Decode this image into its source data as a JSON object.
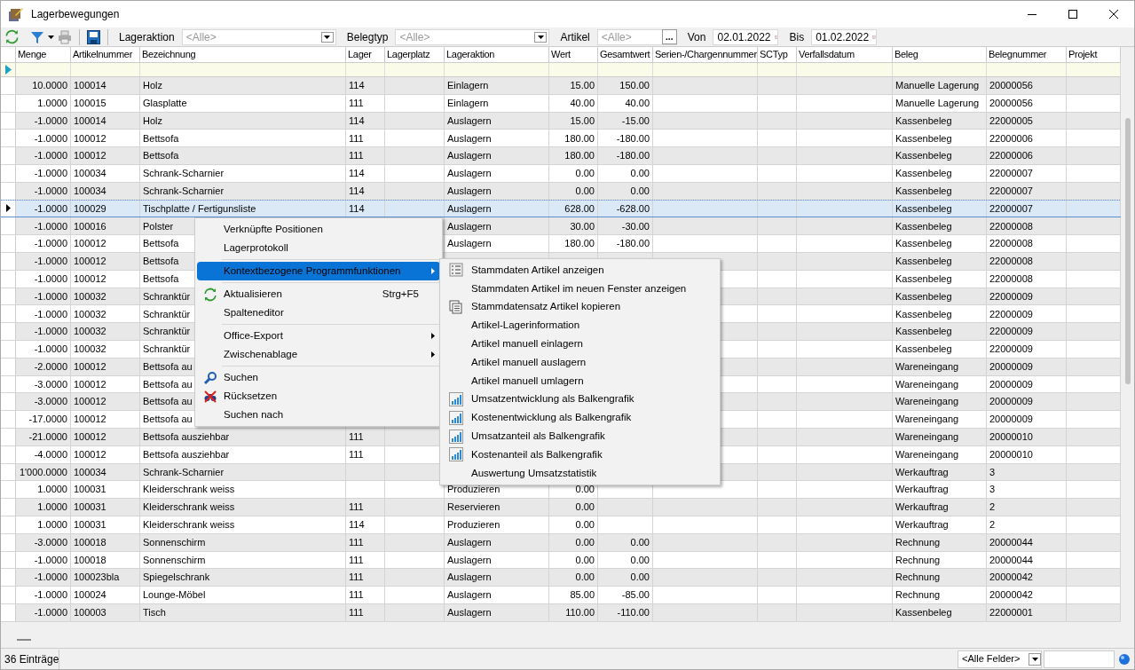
{
  "window": {
    "title": "Lagerbewegungen"
  },
  "toolbar": {
    "filters": [
      {
        "kind": "select",
        "label": "Lageraktion",
        "placeholder": "<Alle>"
      },
      {
        "kind": "select",
        "label": "Belegtyp",
        "placeholder": "<Alle>"
      },
      {
        "kind": "lookup",
        "label": "Artikel",
        "placeholder": "<Alle>",
        "button": "..."
      },
      {
        "kind": "date",
        "label": "Von",
        "value": "02.01.2022"
      },
      {
        "kind": "date",
        "label": "Bis",
        "value": "01.02.2022"
      }
    ]
  },
  "table": {
    "columns": [
      "Menge",
      "Artikelnummer",
      "Bezeichnung",
      "Lager",
      "Lagerplatz",
      "Lageraktion",
      "Wert",
      "Gesamtwert",
      "Serien-/Chargennummer",
      "SCTyp",
      "Verfallsdatum",
      "Beleg",
      "Belegnummer",
      "Projekt"
    ],
    "rows": [
      {
        "selected": false,
        "cells": [
          "10.0000",
          "100014",
          "Holz",
          "114",
          null,
          "Einlagern",
          "15.00",
          "150.00",
          null,
          null,
          null,
          "Manuelle Lagerung",
          "20000056",
          null
        ]
      },
      {
        "selected": false,
        "cells": [
          "1.0000",
          "100015",
          "Glasplatte",
          "111",
          null,
          "Einlagern",
          "40.00",
          "40.00",
          null,
          null,
          null,
          "Manuelle Lagerung",
          "20000056",
          null
        ]
      },
      {
        "selected": false,
        "cells": [
          "-1.0000",
          "100014",
          "Holz",
          "114",
          null,
          "Auslagern",
          "15.00",
          "-15.00",
          null,
          null,
          null,
          "Kassenbeleg",
          "22000005",
          null
        ]
      },
      {
        "selected": false,
        "cells": [
          "-1.0000",
          "100012",
          "Bettsofa",
          "111",
          null,
          "Auslagern",
          "180.00",
          "-180.00",
          null,
          null,
          null,
          "Kassenbeleg",
          "22000006",
          null
        ]
      },
      {
        "selected": false,
        "cells": [
          "-1.0000",
          "100012",
          "Bettsofa",
          "111",
          null,
          "Auslagern",
          "180.00",
          "-180.00",
          null,
          null,
          null,
          "Kassenbeleg",
          "22000006",
          null
        ]
      },
      {
        "selected": false,
        "cells": [
          "-1.0000",
          "100034",
          "Schrank-Scharnier",
          "114",
          null,
          "Auslagern",
          "0.00",
          "0.00",
          null,
          null,
          null,
          "Kassenbeleg",
          "22000007",
          null
        ]
      },
      {
        "selected": false,
        "cells": [
          "-1.0000",
          "100034",
          "Schrank-Scharnier",
          "114",
          null,
          "Auslagern",
          "0.00",
          "0.00",
          null,
          null,
          null,
          "Kassenbeleg",
          "22000007",
          null
        ]
      },
      {
        "selected": true,
        "cells": [
          "-1.0000",
          "100029",
          "Tischplatte / Fertigunsliste",
          "114",
          null,
          "Auslagern",
          "628.00",
          "-628.00",
          null,
          null,
          null,
          "Kassenbeleg",
          "22000007",
          null
        ]
      },
      {
        "selected": false,
        "cells": [
          "-1.0000",
          "100016",
          "Polster",
          null,
          null,
          "Auslagern",
          "30.00",
          "-30.00",
          null,
          null,
          null,
          "Kassenbeleg",
          "22000008",
          null
        ]
      },
      {
        "selected": false,
        "cells": [
          "-1.0000",
          "100012",
          "Bettsofa",
          null,
          null,
          "Auslagern",
          "180.00",
          "-180.00",
          null,
          null,
          null,
          "Kassenbeleg",
          "22000008",
          null
        ]
      },
      {
        "selected": false,
        "cells": [
          "-1.0000",
          "100012",
          "Bettsofa",
          null,
          null,
          null,
          null,
          null,
          null,
          null,
          null,
          "Kassenbeleg",
          "22000008",
          null
        ]
      },
      {
        "selected": false,
        "cells": [
          "-1.0000",
          "100012",
          "Bettsofa",
          null,
          null,
          null,
          null,
          null,
          null,
          null,
          null,
          "Kassenbeleg",
          "22000008",
          null
        ]
      },
      {
        "selected": false,
        "cells": [
          "-1.0000",
          "100032",
          "Schranktür",
          null,
          null,
          null,
          null,
          null,
          null,
          null,
          null,
          "Kassenbeleg",
          "22000009",
          null
        ]
      },
      {
        "selected": false,
        "cells": [
          "-1.0000",
          "100032",
          "Schranktür",
          null,
          null,
          null,
          null,
          null,
          null,
          null,
          null,
          "Kassenbeleg",
          "22000009",
          null
        ]
      },
      {
        "selected": false,
        "cells": [
          "-1.0000",
          "100032",
          "Schranktür",
          null,
          null,
          null,
          null,
          null,
          null,
          null,
          null,
          "Kassenbeleg",
          "22000009",
          null
        ]
      },
      {
        "selected": false,
        "cells": [
          "-1.0000",
          "100032",
          "Schranktür",
          null,
          null,
          null,
          null,
          null,
          null,
          null,
          null,
          "Kassenbeleg",
          "22000009",
          null
        ]
      },
      {
        "selected": false,
        "cells": [
          "-2.0000",
          "100012",
          "Bettsofa au",
          null,
          null,
          null,
          null,
          null,
          null,
          null,
          null,
          "Wareneingang",
          "20000009",
          null
        ]
      },
      {
        "selected": false,
        "cells": [
          "-3.0000",
          "100012",
          "Bettsofa au",
          null,
          null,
          null,
          null,
          null,
          null,
          null,
          null,
          "Wareneingang",
          "20000009",
          null
        ]
      },
      {
        "selected": false,
        "cells": [
          "-3.0000",
          "100012",
          "Bettsofa au",
          null,
          null,
          null,
          null,
          null,
          null,
          null,
          null,
          "Wareneingang",
          "20000009",
          null
        ]
      },
      {
        "selected": false,
        "cells": [
          "-17.0000",
          "100012",
          "Bettsofa au",
          null,
          null,
          null,
          null,
          null,
          null,
          null,
          null,
          "Wareneingang",
          "20000009",
          null
        ]
      },
      {
        "selected": false,
        "cells": [
          "-21.0000",
          "100012",
          "Bettsofa ausziehbar",
          "111",
          null,
          null,
          null,
          null,
          null,
          null,
          null,
          "Wareneingang",
          "20000010",
          null
        ]
      },
      {
        "selected": false,
        "cells": [
          "-4.0000",
          "100012",
          "Bettsofa ausziehbar",
          "111",
          null,
          null,
          null,
          null,
          null,
          null,
          null,
          "Wareneingang",
          "20000010",
          null
        ]
      },
      {
        "selected": false,
        "cells": [
          "1'000.0000",
          "100034",
          "Schrank-Scharnier",
          null,
          null,
          null,
          null,
          null,
          null,
          null,
          null,
          "Werkauftrag",
          "3",
          null
        ]
      },
      {
        "selected": false,
        "cells": [
          "1.0000",
          "100031",
          "Kleiderschrank weiss",
          null,
          null,
          "Produzieren",
          "0.00",
          null,
          null,
          null,
          null,
          "Werkauftrag",
          "3",
          null
        ]
      },
      {
        "selected": false,
        "cells": [
          "1.0000",
          "100031",
          "Kleiderschrank weiss",
          "111",
          null,
          "Reservieren",
          "0.00",
          null,
          null,
          null,
          null,
          "Werkauftrag",
          "2",
          null
        ]
      },
      {
        "selected": false,
        "cells": [
          "1.0000",
          "100031",
          "Kleiderschrank weiss",
          "114",
          null,
          "Produzieren",
          "0.00",
          null,
          null,
          null,
          null,
          "Werkauftrag",
          "2",
          null
        ]
      },
      {
        "selected": false,
        "cells": [
          "-3.0000",
          "100018",
          "Sonnenschirm",
          "111",
          null,
          "Auslagern",
          "0.00",
          "0.00",
          null,
          null,
          null,
          "Rechnung",
          "20000044",
          null
        ]
      },
      {
        "selected": false,
        "cells": [
          "-1.0000",
          "100018",
          "Sonnenschirm",
          "111",
          null,
          "Auslagern",
          "0.00",
          "0.00",
          null,
          null,
          null,
          "Rechnung",
          "20000044",
          null
        ]
      },
      {
        "selected": false,
        "cells": [
          "-1.0000",
          "100023bla",
          "Spiegelschrank",
          "111",
          null,
          "Auslagern",
          "0.00",
          "0.00",
          null,
          null,
          null,
          "Rechnung",
          "20000042",
          null
        ]
      },
      {
        "selected": false,
        "cells": [
          "-1.0000",
          "100024",
          "Lounge-Möbel",
          "111",
          null,
          "Auslagern",
          "85.00",
          "-85.00",
          null,
          null,
          null,
          "Rechnung",
          "20000042",
          null
        ]
      },
      {
        "selected": false,
        "cells": [
          "-1.0000",
          "100003",
          "Tisch",
          "111",
          null,
          "Auslagern",
          "110.00",
          "-110.00",
          null,
          null,
          null,
          "Kassenbeleg",
          "22000001",
          null
        ]
      }
    ]
  },
  "context_menu": {
    "items": [
      {
        "kind": "item",
        "label": "Verknüpfte Positionen",
        "selected": false
      },
      {
        "kind": "item",
        "label": "Lagerprotokoll",
        "selected": false
      },
      {
        "kind": "separator"
      },
      {
        "kind": "submenu",
        "label": "Kontextbezogene Programmfunktionen",
        "selected": true
      },
      {
        "kind": "separator"
      },
      {
        "kind": "refresh",
        "label": "Aktualisieren",
        "shortcut": "Strg+F5",
        "selected": false
      },
      {
        "kind": "item",
        "label": "Spalteneditor",
        "selected": false
      },
      {
        "kind": "separator"
      },
      {
        "kind": "submenu",
        "label": "Office-Export",
        "selected": false
      },
      {
        "kind": "submenu",
        "label": "Zwischenablage",
        "selected": false
      },
      {
        "kind": "separator"
      },
      {
        "kind": "search",
        "label": "Suchen",
        "selected": false
      },
      {
        "kind": "reset",
        "label": "Rücksetzen",
        "selected": false
      },
      {
        "kind": "item",
        "label": "Suchen nach",
        "selected": false
      }
    ]
  },
  "submenu": {
    "items": [
      {
        "kind": "list",
        "label": "Stammdaten Artikel anzeigen"
      },
      {
        "kind": "plain",
        "label": "Stammdaten Artikel im neuen Fenster anzeigen"
      },
      {
        "kind": "copy",
        "label": "Stammdatensatz Artikel kopieren"
      },
      {
        "kind": "plain",
        "label": "Artikel-Lagerinformation"
      },
      {
        "kind": "plain",
        "label": "Artikel manuell einlagern"
      },
      {
        "kind": "plain",
        "label": "Artikel manuell auslagern"
      },
      {
        "kind": "plain",
        "label": "Artikel manuell umlagern"
      },
      {
        "kind": "chart",
        "label": "Umsatzentwicklung als Balkengrafik"
      },
      {
        "kind": "chart",
        "label": "Kostenentwicklung als Balkengrafik"
      },
      {
        "kind": "chart",
        "label": "Umsatzanteil als Balkengrafik"
      },
      {
        "kind": "chart",
        "label": "Kostenanteil als Balkengrafik"
      },
      {
        "kind": "plain",
        "label": "Auswertung Umsatzstatistik"
      }
    ]
  },
  "status_bar": {
    "count": "36 Einträge",
    "field_select": "<Alle Felder>"
  }
}
